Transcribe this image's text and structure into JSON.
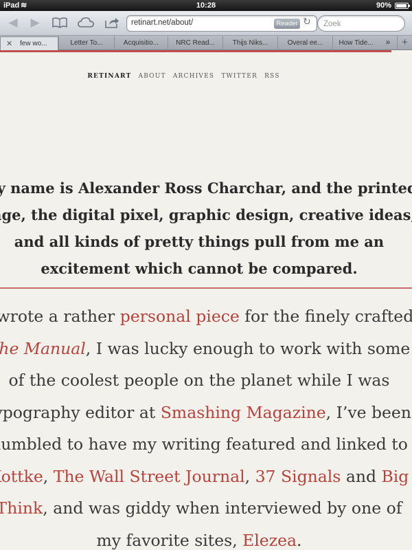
{
  "status_bar": {
    "carrier": "iPad",
    "time": "10:28",
    "battery": "90%"
  },
  "toolbar": {
    "back_icon": "back-arrow-icon",
    "forward_icon": "forward-arrow-icon",
    "bookmarks_icon": "book-icon",
    "icloud_icon": "cloud-icon",
    "share_icon": "share-icon",
    "url": "retinart.net/about/",
    "reader_label": "Reader",
    "search_placeholder": "Zoek"
  },
  "tabs": [
    {
      "label": "few wo..."
    },
    {
      "label": "Letter To..."
    },
    {
      "label": "Acquisitio..."
    },
    {
      "label": "NRC Read..."
    },
    {
      "label": "Thijs Niks..."
    },
    {
      "label": "Overal ee..."
    },
    {
      "label": "How Tide..."
    }
  ],
  "tab_more": "»",
  "tab_new": "+",
  "site_nav": {
    "brand": "RETINART",
    "items": [
      "ABOUT",
      "ARCHIVES",
      "TWITTER",
      "RSS"
    ]
  },
  "intro_lines": [
    "My name is Alexander Ross Charchar, and the printed",
    "page, the digital pixel, graphic design, creative ideas,",
    "and all kinds of pretty things pull from me an",
    "excitement which cannot be compared."
  ],
  "body": {
    "l1_a": "I wrote a rather ",
    "l1_link": "personal piece",
    "l1_b": " for the finely crafted",
    "l2_link": "The Manual",
    "l2_b": ", I was lucky enough to work with some",
    "l3": "of the coolest people on the planet while I was",
    "l4_a": "typography editor at ",
    "l4_link": "Smashing Magazine",
    "l4_b": ", I’ve been",
    "l5": "humbled to have my writing featured and linked to",
    "l6_link1": "Kottke",
    "l6_sep1": ", ",
    "l6_link2": "The Wall Street Journal",
    "l6_sep2": ", ",
    "l6_link3": "37 Signals",
    "l6_and": " and ",
    "l6_link4": "Big",
    "l7_link": "Think",
    "l7_b": ", and was giddy when interviewed by one of",
    "l8_a": "my favorite sites, ",
    "l8_link": "Elezea",
    "l8_b": "."
  },
  "colors": {
    "accent": "#c0504d",
    "link": "#b8423c",
    "page_bg": "#f3f1ec"
  }
}
